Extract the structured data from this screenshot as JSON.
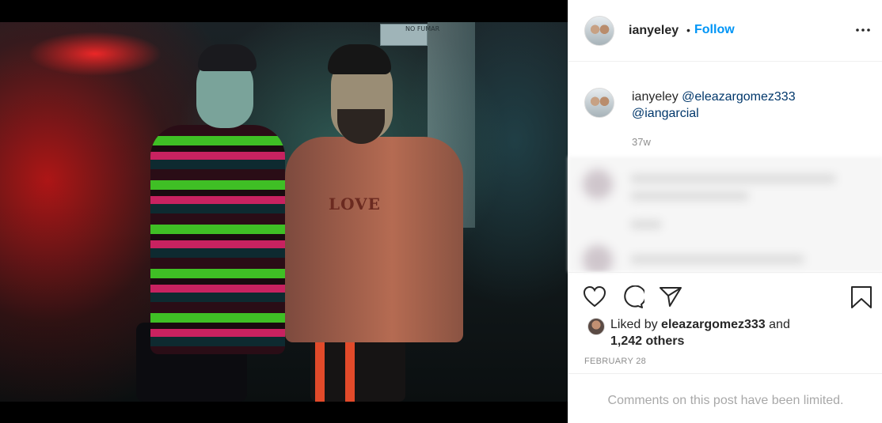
{
  "photo": {
    "sign_text": "NO\nFUMAR",
    "shirt_text": "LOVE"
  },
  "header": {
    "username": "ianyeley",
    "separator": "•",
    "follow_label": "Follow",
    "more_label": "•••"
  },
  "caption": {
    "username": "ianyeley",
    "mentions": [
      "@eleazargomez333",
      "@iangarcial"
    ],
    "time": "37w"
  },
  "likes": {
    "prefix": "Liked by",
    "user": "eleazargomez333",
    "connector": "and",
    "others": "1,242 others"
  },
  "date": "FEBRUARY 28",
  "comments_limited": "Comments on this post have been limited.",
  "icons": [
    "heart-icon",
    "comment-icon",
    "share-icon",
    "save-icon",
    "more-icon"
  ],
  "colors": {
    "accent": "#0095f6",
    "mention": "#00376b",
    "muted": "#8e8e8e"
  }
}
